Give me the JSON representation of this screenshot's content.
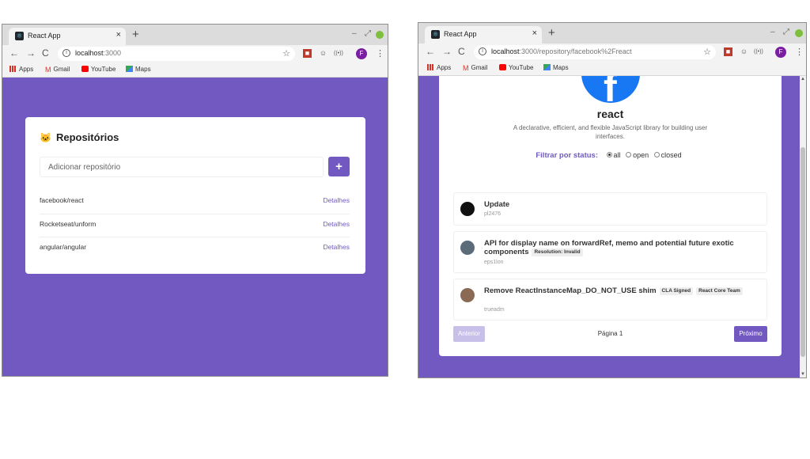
{
  "colors": {
    "accent": "#7159c1",
    "accent_disabled": "#c9c0ea",
    "facebook_blue": "#1877f2",
    "avatar_purple": "#7b1fa2"
  },
  "window1": {
    "tab_title": "React App",
    "tab_close": "×",
    "new_tab": "+",
    "url_host": "localhost",
    "url_rest": ":3000",
    "avatar_letter": "F",
    "bookmarks": [
      "Apps",
      "Gmail",
      "YouTube",
      "Maps"
    ],
    "heading": "Repositórios",
    "input_placeholder": "Adicionar repositório",
    "add_label": "+",
    "repos": [
      {
        "name": "facebook/react",
        "link": "Detalhes"
      },
      {
        "name": "Rocketseat/unform",
        "link": "Detalhes"
      },
      {
        "name": "angular/angular",
        "link": "Detalhes"
      }
    ]
  },
  "window2": {
    "tab_title": "React App",
    "tab_close": "×",
    "new_tab": "+",
    "url_host": "localhost",
    "url_rest": ":3000/repository/facebook%2Freact",
    "avatar_letter": "F",
    "bookmarks": [
      "Apps",
      "Gmail",
      "YouTube",
      "Maps"
    ],
    "repo_name": "react",
    "repo_description": "A declarative, efficient, and flexible JavaScript library for building user interfaces.",
    "filter_label": "Filtrar por status:",
    "filter_options": [
      "all",
      "open",
      "closed"
    ],
    "filter_selected": "all",
    "issues": [
      {
        "title": "Update",
        "labels": [],
        "user": "pl2476"
      },
      {
        "title": "API for display name on forwardRef, memo and potential future exotic components",
        "labels": [
          "Resolution: Invalid"
        ],
        "user": "eps1lon"
      },
      {
        "title": "Remove ReactInstanceMap_DO_NOT_USE shim",
        "labels": [
          "CLA Signed",
          "React Core Team"
        ],
        "user": "trueadm"
      }
    ],
    "prev_label": "Anterior",
    "page_label": "Página 1",
    "next_label": "Próximo"
  }
}
